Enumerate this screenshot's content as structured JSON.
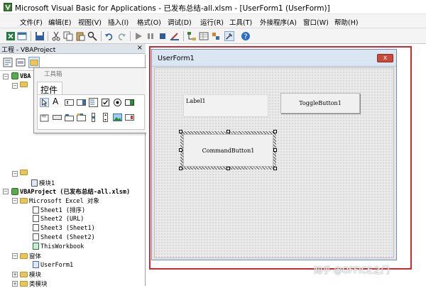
{
  "window": {
    "title": "Microsoft Visual Basic for Applications - 已发布总结-all.xlsm - [UserForm1 (UserForm)]"
  },
  "menu": [
    "文件(F)",
    "编辑(E)",
    "视图(V)",
    "插入(I)",
    "格式(O)",
    "调试(D)",
    "运行(R)",
    "工具(T)",
    "外接程序(A)",
    "窗口(W)",
    "帮助(H)"
  ],
  "project": {
    "title": "工程 - VBAProject",
    "close": "×",
    "tree": {
      "vba_short": "VBA",
      "module1": "模块1",
      "vbaproject": "VBAProject (已发布总结-all.xlsm)",
      "excel_objects": "Microsoft Excel 对象",
      "sheet1": "Sheet1 (排序)",
      "sheet2": "Sheet2 (URL)",
      "sheet3": "Sheet3 (Sheet1)",
      "sheet4": "Sheet4 (Sheet2)",
      "thisworkbook": "ThisWorkbook",
      "forms": "窗体",
      "userform1": "UserForm1",
      "modules": "模块",
      "class_modules": "类模块"
    }
  },
  "toolbox": {
    "title": "工具箱",
    "tab": "控件",
    "label_tool": "A"
  },
  "userform": {
    "title": "UserForm1",
    "close": "x",
    "label1": "Label1",
    "toggle": "ToggleButton1",
    "command": "CommandButton1"
  },
  "watermark": "知乎 @OFFICE之门",
  "colors": {
    "highlight_frame": "#d4272d",
    "form_title_bg": "#dbe6f3",
    "close_button": "#c84a3c"
  }
}
